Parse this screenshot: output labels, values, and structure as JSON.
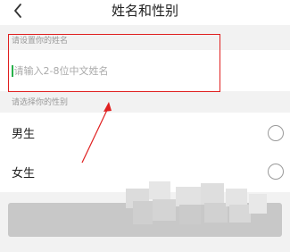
{
  "header": {
    "title": "姓名和性别",
    "back_icon": "chevron-left-icon"
  },
  "name_section": {
    "label": "请设置你的姓名",
    "input_placeholder": "请输入2-8位中文姓名",
    "input_value": ""
  },
  "gender_section": {
    "label": "请选择你的性别",
    "options": [
      {
        "label": "男生",
        "selected": false
      },
      {
        "label": "女生",
        "selected": false
      }
    ]
  },
  "submit_button": {
    "label": "",
    "state": "disabled"
  },
  "annotation": {
    "frame_color": "#e02020",
    "arrow_color": "#e02020"
  },
  "colors": {
    "caret": "#27b24a",
    "background": "#f2f2f2",
    "button_disabled": "#c8c8c8"
  }
}
